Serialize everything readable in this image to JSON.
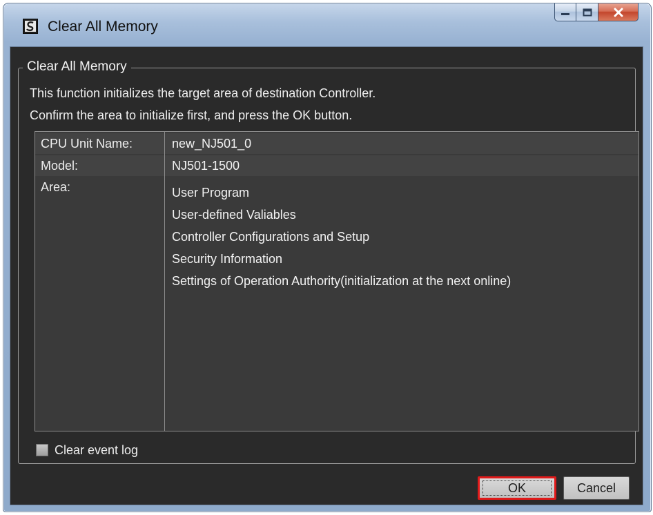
{
  "window": {
    "title": "Clear All Memory",
    "icon": "app-icon"
  },
  "group": {
    "title": "Clear All Memory",
    "description_line1": "This function initializes the target area of destination Controller.",
    "description_line2": "Confirm the area to initialize first, and press the OK button."
  },
  "info": {
    "cpu_unit_name_label": "CPU Unit Name:",
    "cpu_unit_name_value": "new_NJ501_0",
    "model_label": "Model:",
    "model_value": "NJ501-1500",
    "area_label": "Area:",
    "areas": [
      "User Program",
      "User-defined Valiables",
      "Controller Configurations and Setup",
      "Security Information",
      "Settings of Operation Authority(initialization at the next online)"
    ]
  },
  "options": {
    "clear_event_log_label": "Clear event log",
    "clear_event_log_checked": false
  },
  "buttons": {
    "ok_label": "OK",
    "cancel_label": "Cancel"
  },
  "colors": {
    "highlight": "#e01a1a",
    "dialog_background": "#2a2a2a"
  }
}
